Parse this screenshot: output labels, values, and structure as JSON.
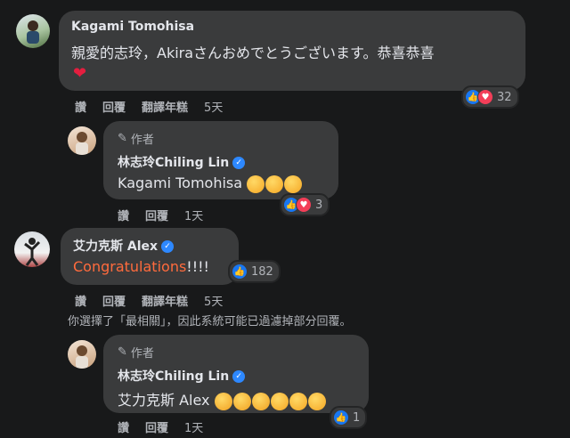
{
  "comments": {
    "c1": {
      "author": "Kagami Tomohisa",
      "text": "親愛的志玲，Akiraさんおめでとうございます。恭喜恭喜",
      "heart_emoji": "❤",
      "reaction_count": "32",
      "actions": [
        "讚",
        "回覆",
        "翻譯年糕"
      ],
      "time": "5天"
    },
    "r1": {
      "author_tag": "作者",
      "author": "林志玲Chiling Lin",
      "mention": "Kagami Tomohisa",
      "reaction_count": "3",
      "actions": [
        "讚",
        "回覆"
      ],
      "time": "1天"
    },
    "c2": {
      "author": "艾力克斯 Alex",
      "text_highlight": "Congratulations",
      "text_suffix": "!!!!",
      "reaction_count": "182",
      "actions": [
        "讚",
        "回覆",
        "翻譯年糕"
      ],
      "time": "5天"
    },
    "notice": "你選擇了「最相關」，因此系統可能已過濾掉部分回覆。",
    "r2": {
      "author_tag": "作者",
      "author": "林志玲Chiling Lin",
      "mention": "艾力克斯 Alex",
      "reaction_count": "1",
      "actions": [
        "讚",
        "回覆"
      ],
      "time": "1天"
    }
  },
  "colors": {
    "background": "#18191a",
    "bubble": "#3a3b3c",
    "like": "#1877f2",
    "love": "#f33e58",
    "verified": "#2d88ff",
    "congrats": "#ff6b3d"
  }
}
